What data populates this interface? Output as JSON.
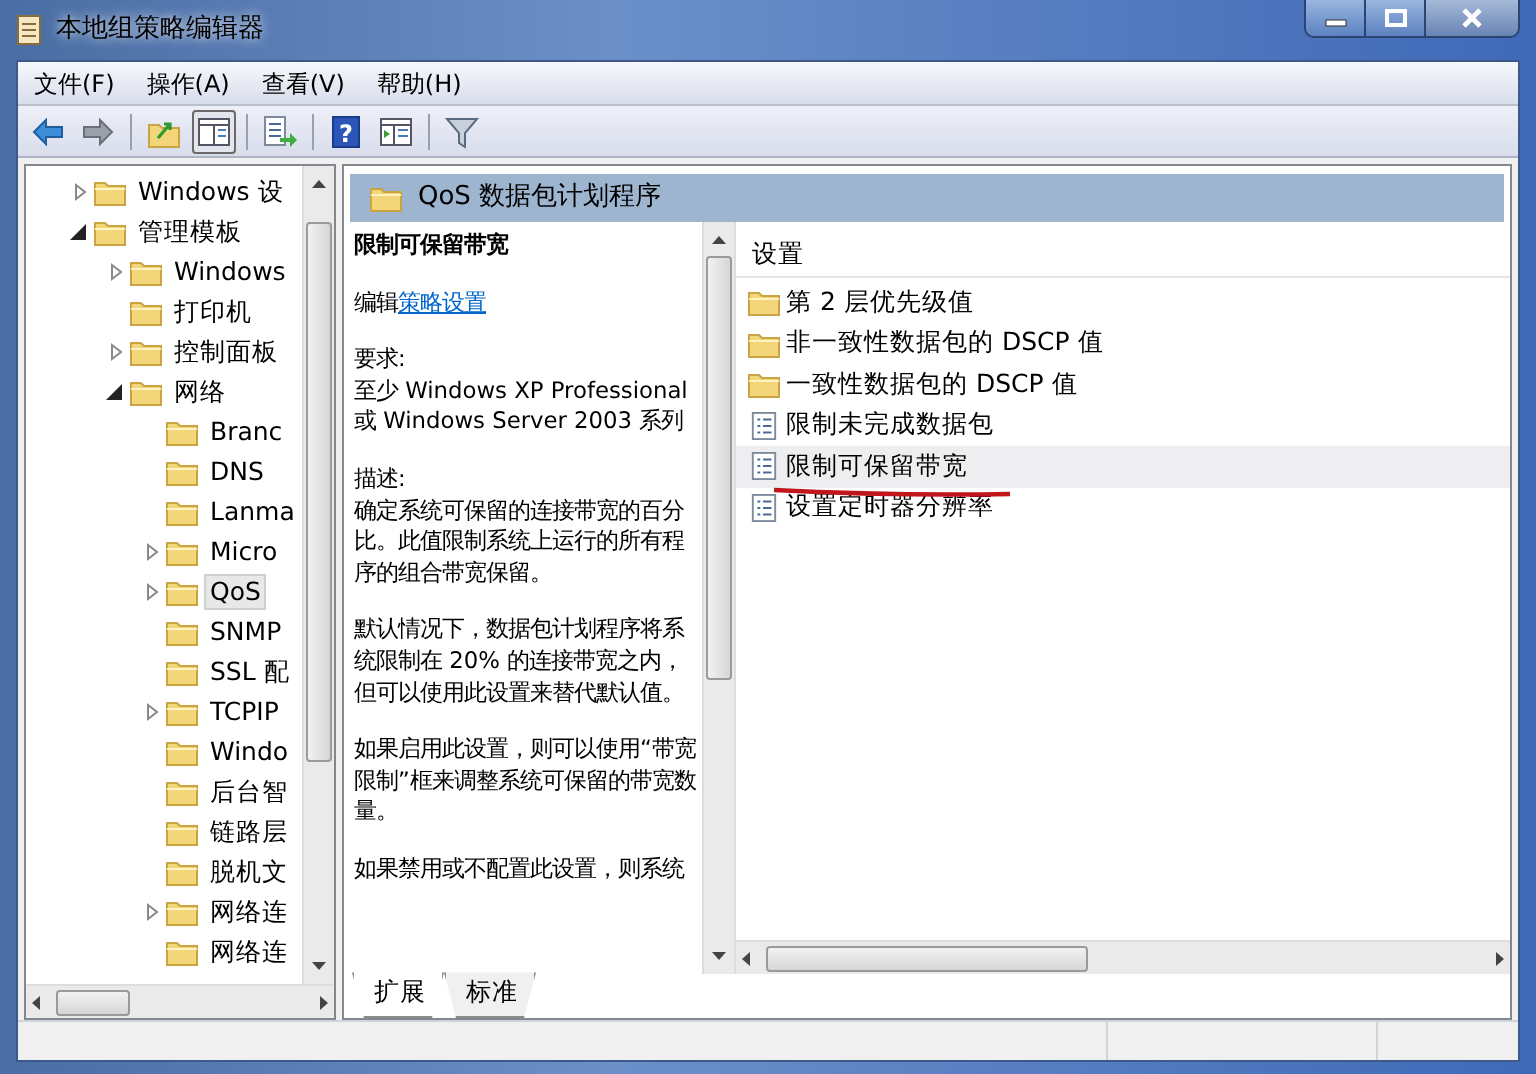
{
  "window": {
    "title": "本地组策略编辑器"
  },
  "menu": [
    "文件(F)",
    "操作(A)",
    "查看(V)",
    "帮助(H)"
  ],
  "toolbar": [
    {
      "kind": "back",
      "pressed": false
    },
    {
      "kind": "forward",
      "pressed": false
    },
    {
      "kind": "sep"
    },
    {
      "kind": "up",
      "pressed": false
    },
    {
      "kind": "pane",
      "pressed": true
    },
    {
      "kind": "sep"
    },
    {
      "kind": "export",
      "pressed": false
    },
    {
      "kind": "sep"
    },
    {
      "kind": "help",
      "pressed": false,
      "glyph": "?"
    },
    {
      "kind": "pane2",
      "pressed": false
    },
    {
      "kind": "sep"
    },
    {
      "kind": "filter",
      "pressed": false
    }
  ],
  "tree": [
    {
      "label": "Windows 设",
      "has_children": true,
      "expanded": false,
      "selected": false
    },
    {
      "label": "管理模板",
      "has_children": true,
      "expanded": true,
      "selected": false,
      "children": [
        {
          "label": "Windows",
          "has_children": true,
          "expanded": false,
          "selected": false
        },
        {
          "label": "打印机",
          "has_children": false,
          "selected": false
        },
        {
          "label": "控制面板",
          "has_children": true,
          "expanded": false,
          "selected": false
        },
        {
          "label": "网络",
          "has_children": true,
          "expanded": true,
          "selected": false,
          "children": [
            {
              "label": "Branc",
              "has_children": false,
              "selected": false
            },
            {
              "label": "DNS",
              "has_children": false,
              "selected": false
            },
            {
              "label": "Lanma",
              "has_children": false,
              "selected": false
            },
            {
              "label": "Micro",
              "has_children": true,
              "expanded": false,
              "selected": false
            },
            {
              "label": "QoS",
              "has_children": true,
              "expanded": false,
              "selected": true
            },
            {
              "label": "SNMP",
              "has_children": false,
              "selected": false
            },
            {
              "label": "SSL 配",
              "has_children": false,
              "selected": false
            },
            {
              "label": "TCPIP",
              "has_children": true,
              "expanded": false,
              "selected": false
            },
            {
              "label": "Windo",
              "has_children": false,
              "selected": false
            },
            {
              "label": "后台智",
              "has_children": false,
              "selected": false
            },
            {
              "label": "链路层",
              "has_children": false,
              "selected": false
            },
            {
              "label": "脱机文",
              "has_children": false,
              "selected": false
            },
            {
              "label": "网络连",
              "has_children": true,
              "expanded": false,
              "selected": false
            },
            {
              "label": "网络连",
              "has_children": false,
              "selected": false
            }
          ]
        }
      ]
    }
  ],
  "details": {
    "header": "QoS 数据包计划程序",
    "title": "限制可保留带宽",
    "edit_prefix": "编辑",
    "edit_link": "策略设置",
    "requirements_label": "要求:",
    "requirements": "至少 Windows XP Professional 或 Windows Server 2003 系列",
    "description_label": "描述:",
    "paragraphs": [
      "确定系统可保留的连接带宽的百分比。此值限制系统上运行的所有程序的组合带宽保留。",
      "默认情况下，数据包计划程序将系统限制在 20% 的连接带宽之内，但可以使用此设置来替代默认值。",
      "如果启用此设置，则可以使用“带宽限制”框来调整系统可保留的带宽数量。",
      "如果禁用或不配置此设置，则系统"
    ]
  },
  "settings": {
    "column": "设置",
    "rows": [
      {
        "kind": "folder",
        "label": "第 2 层优先级值",
        "selected": false
      },
      {
        "kind": "folder",
        "label": "非一致性数据包的 DSCP 值",
        "selected": false
      },
      {
        "kind": "folder",
        "label": "一致性数据包的 DSCP 值",
        "selected": false
      },
      {
        "kind": "setting",
        "label": "限制未完成数据包",
        "selected": false
      },
      {
        "kind": "setting",
        "label": "限制可保留带宽",
        "selected": true,
        "underlined": true
      },
      {
        "kind": "setting",
        "label": "设置定时器分辨率",
        "selected": false
      }
    ]
  },
  "bottom_tabs": [
    {
      "label": "扩展",
      "selected": true
    },
    {
      "label": "标准",
      "selected": false
    }
  ]
}
